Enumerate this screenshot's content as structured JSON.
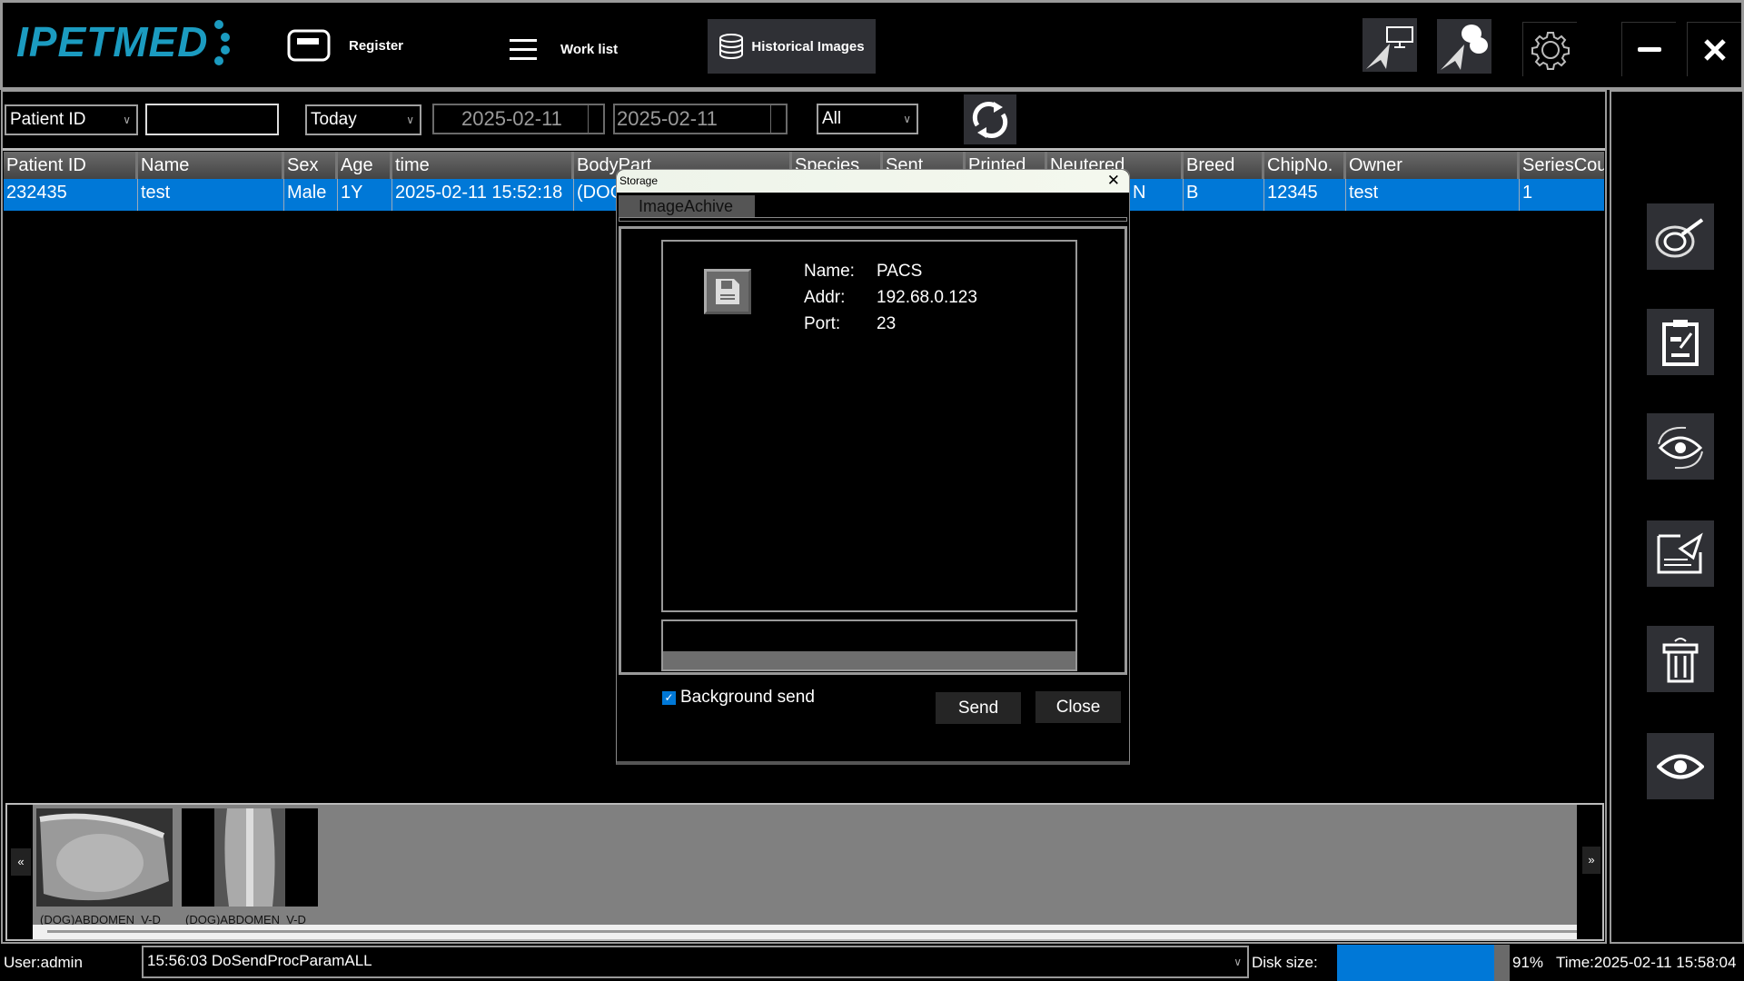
{
  "header": {
    "logo": "IPETMED",
    "register_label": "Register",
    "worklist_label": "Work list",
    "historical_label": "Historical Images"
  },
  "filters": {
    "field_select": "Patient ID",
    "search_value": "",
    "range_select": "Today",
    "date_from": "2025-02-11",
    "date_to": "2025-02-11",
    "status_select": "All"
  },
  "table": {
    "columns": [
      "Patient ID",
      "Name",
      "Sex",
      "Age",
      "time",
      "BodyPart",
      "Species",
      "Sent",
      "Printed",
      "Neutered",
      "Breed",
      "ChipNo.",
      "Owner",
      "SeriesCou"
    ],
    "rows": [
      {
        "patient_id": "232435",
        "name": "test",
        "sex": "Male",
        "age": "1Y",
        "time": "2025-02-11 15:52:18",
        "bodypart": "(DOG",
        "neutered": "N",
        "breed": "B",
        "chip": "12345",
        "owner": "test",
        "series": "1"
      }
    ]
  },
  "dialog": {
    "title": "Storage",
    "tab": "ImageAchive",
    "name_label": "Name:",
    "name_value": "PACS",
    "addr_label": "Addr:",
    "addr_value": "192.68.0.123",
    "port_label": "Port:",
    "port_value": "23",
    "background_send_label": "Background send",
    "background_send_checked": true,
    "send_label": "Send",
    "close_label": "Close"
  },
  "thumbnails": [
    {
      "label": "(DOG)ABDOMEN  V-D"
    },
    {
      "label": "(DOG)ABDOMEN  V-D"
    }
  ],
  "nav": {
    "prev": "«",
    "next": "»"
  },
  "status": {
    "user": "User:admin",
    "log": "15:56:03 DoSendProcParamALL",
    "disk_label": "Disk size:",
    "disk_percent": 91,
    "disk_text": "91%",
    "time": "Time:2025-02-11 15:58:04"
  },
  "colors": {
    "accent": "#0078d7",
    "logo": "#1b9bc0"
  }
}
